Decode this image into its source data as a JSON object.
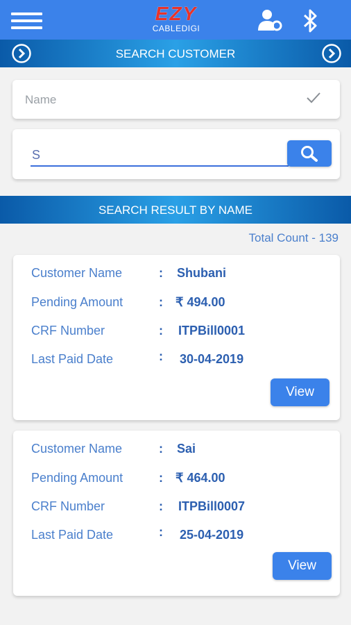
{
  "header": {
    "logo_main": "EZY",
    "logo_sub": "CABLEDIGI",
    "icons": [
      "hamburger-menu-icon",
      "user-settings-icon",
      "bluetooth-icon"
    ]
  },
  "search_customer": {
    "title": "SEARCH CUSTOMER",
    "name_filter_label": "Name",
    "query_value": "S"
  },
  "results": {
    "title": "SEARCH RESULT BY NAME",
    "total_count": "Total Count - 139",
    "labels": {
      "customer_name": "Customer Name",
      "pending_amount": "Pending Amount",
      "crf_number": "CRF Number",
      "last_paid_date": "Last Paid Date",
      "colon": ":"
    },
    "items": [
      {
        "customer_name": "Shubani",
        "pending_amount": "₹ 494.00",
        "crf_number": "ITPBill0001",
        "last_paid_date": "30-04-2019",
        "view_label": "View"
      },
      {
        "customer_name": "Sai",
        "pending_amount": "₹ 464.00",
        "crf_number": "ITPBill0007",
        "last_paid_date": "25-04-2019",
        "view_label": "View"
      }
    ]
  },
  "colors": {
    "appbar": "#3b82ea",
    "banner_dark": "#0a5aa8",
    "banner_light": "#2aa0e6",
    "label_text": "#4a7fcc",
    "value_text": "#2c5fb0",
    "logo_red": "#e8332a"
  }
}
